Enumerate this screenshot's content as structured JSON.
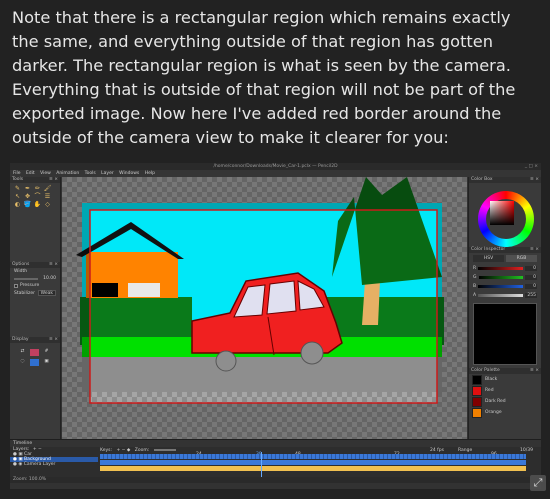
{
  "article": {
    "paragraph": "Note that there is a rectangular region which remains exactly the same, and everything outside of that region has gotten darker. The rectangular region is what is seen by the camera. Everything that is outside of that region will not be part of the exported image. Now here I've added red border around the outside of the camera view to make it clearer for you:"
  },
  "window": {
    "title": "/home/connor/Downloads/Movie_Car-1.pclx — Pencil2D",
    "controls": "_ □ ×"
  },
  "menu": [
    "File",
    "Edit",
    "View",
    "Animation",
    "Tools",
    "Layer",
    "Windows",
    "Help"
  ],
  "panels": {
    "tools_title": "Tools",
    "options_title": "Options",
    "display_title": "Display",
    "color_box_title": "Color Box",
    "color_inspector_title": "Color Inspector",
    "color_palette_title": "Color Palette",
    "timeline_title": "Timeline",
    "panel_controls": "≡ ×"
  },
  "tools": [
    "✎",
    "✒",
    "✏",
    "🖌",
    "↖",
    "✥",
    "⌒",
    "☰",
    "◐",
    "🪣",
    "✋",
    "◇"
  ],
  "options": {
    "width_label": "Width",
    "width_value": "10.00",
    "pressure_label": "Pressure",
    "stabilizer_label": "Stabilizer",
    "stabilizer_value": "Weak"
  },
  "inspector": {
    "tabs": [
      "HSV",
      "RGB"
    ],
    "rows": [
      {
        "label": "R",
        "value": "0",
        "color": "#e02020"
      },
      {
        "label": "G",
        "value": "0",
        "color": "#20c020"
      },
      {
        "label": "B",
        "value": "0",
        "color": "#2060e0"
      },
      {
        "label": "A",
        "value": "255",
        "color": "#bbbbbb"
      }
    ]
  },
  "palette": [
    {
      "name": "Black",
      "color": "#000000"
    },
    {
      "name": "Red",
      "color": "#e01010"
    },
    {
      "name": "Dark Red",
      "color": "#800000"
    },
    {
      "name": "Orange",
      "color": "#f08000"
    }
  ],
  "timeline": {
    "layers_label": "Layers:",
    "keys_label": "Keys:",
    "zoom_label": "Zoom:",
    "fps": "24 fps",
    "range_label": "Range",
    "frame_counter": "10/39",
    "ticks": [
      "24",
      "39",
      "48",
      "72",
      "96"
    ],
    "layers": [
      {
        "name": "Car",
        "selected": false
      },
      {
        "name": "Background",
        "selected": true
      },
      {
        "name": "Camera Layer",
        "selected": false
      }
    ]
  },
  "status": {
    "zoom": "Zoom: 100.0%"
  }
}
